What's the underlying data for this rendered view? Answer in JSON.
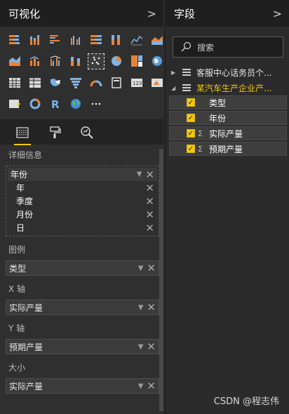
{
  "viz_pane": {
    "title": "可视化",
    "chevron": ">",
    "visual_icons": [
      "stacked-bar-icon",
      "stacked-column-icon",
      "clustered-bar-icon",
      "clustered-column-icon",
      "100-percent-bar-icon",
      "100-percent-column-icon",
      "line-chart-icon",
      "area-chart-icon",
      "stacked-area-icon",
      "line-column-icon",
      "line-clustered-column-icon",
      "ribbon-chart-icon",
      "scatter-chart-icon",
      "pie-chart-icon",
      "treemap-icon",
      "map-icon",
      "table-icon",
      "matrix-icon",
      "filled-map-icon",
      "funnel-icon",
      "gauge-icon",
      "card-icon",
      "multi-row-card-icon",
      "kpi-icon",
      "slicer-icon",
      "donut-icon",
      "r-visual-icon",
      "globe-icon",
      "more-icon"
    ],
    "selected_visual": "scatter-chart-icon",
    "tabs": [
      "fields-tab-icon",
      "format-tab-icon",
      "analytics-tab-icon"
    ],
    "wells": {
      "details": {
        "title": "详细信息",
        "head": "年份",
        "children": [
          "年",
          "季度",
          "月份",
          "日"
        ]
      },
      "legend": {
        "title": "图例",
        "value": "类型"
      },
      "x_axis": {
        "title": "X 轴",
        "value": "实际产量"
      },
      "y_axis": {
        "title": "Y 轴",
        "value": "预期产量"
      },
      "size": {
        "title": "大小",
        "value": "实际产量"
      }
    }
  },
  "fields_pane": {
    "title": "字段",
    "chevron": ">",
    "search_placeholder": "搜索",
    "tables": [
      {
        "name": "客服中心话务员个...",
        "expanded": false
      },
      {
        "name": "某汽车生产企业产...",
        "expanded": true
      }
    ],
    "fields": [
      {
        "name": "类型",
        "checked": true,
        "sigma": false
      },
      {
        "name": "年份",
        "checked": true,
        "sigma": false
      },
      {
        "name": "实际产量",
        "checked": true,
        "sigma": true
      },
      {
        "name": "预期产量",
        "checked": true,
        "sigma": true
      }
    ]
  },
  "watermark": "CSDN @程志伟",
  "colors": {
    "accent": "#f2c811",
    "pane_bg": "#2f2f2f",
    "header_bg": "#1f1f1f"
  }
}
